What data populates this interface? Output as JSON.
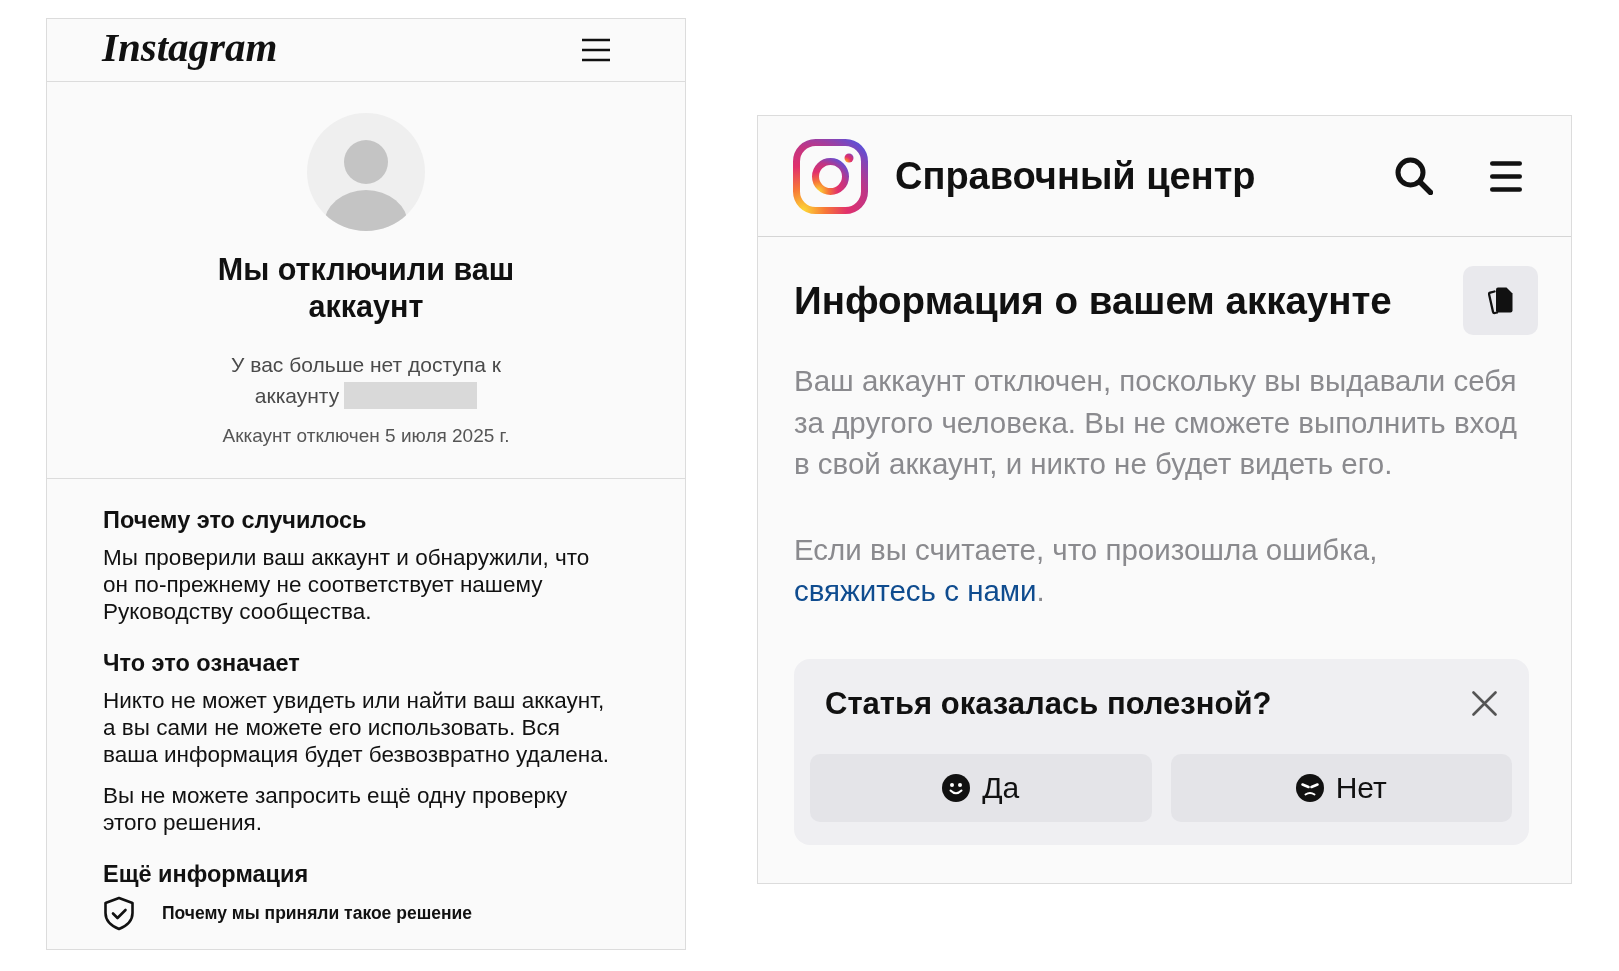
{
  "account_notice": {
    "header": {
      "logo": "Instagram"
    },
    "title": "Мы отключили ваш аккаунт",
    "access_text": "У вас больше нет доступа к",
    "account_label": "аккаунту",
    "disabled_date": "Аккаунт отключен 5 июля 2025 г.",
    "sections": [
      {
        "heading": "Почему это случилось",
        "paragraphs": [
          "Мы проверили ваш аккаунт и обнаружили, что он по-прежнему не соответствует нашему Руководству сообщества."
        ]
      },
      {
        "heading": "Что это означает",
        "paragraphs": [
          "Никто не может увидеть или найти ваш аккаунт, а вы сами не можете его использовать. Вся ваша информация будет безвозвратно удалена.",
          "Вы не можете запросить ещё одну проверку этого решения."
        ]
      },
      {
        "heading": "Ещё информация",
        "links": [
          "Почему мы приняли такое решение"
        ]
      }
    ]
  },
  "help_center": {
    "header": {
      "title": "Справочный центр"
    },
    "article": {
      "title": "Информация о вашем аккаунте",
      "paragraphs": [
        "Ваш аккаунт отключен, поскольку вы выдавали себя за другого человека. Вы не сможете выполнить вход в свой аккаунт, и никто не будет видеть его."
      ],
      "contact": {
        "text": "Если вы считаете, что произошла ошибка,",
        "link": "свяжитесь с нами",
        "end": "."
      }
    },
    "feedback": {
      "question": "Статья оказалась полезной?",
      "buttons": [
        {
          "label": "Да",
          "kind": "yes"
        },
        {
          "label": "Нет",
          "kind": "no"
        }
      ]
    }
  }
}
